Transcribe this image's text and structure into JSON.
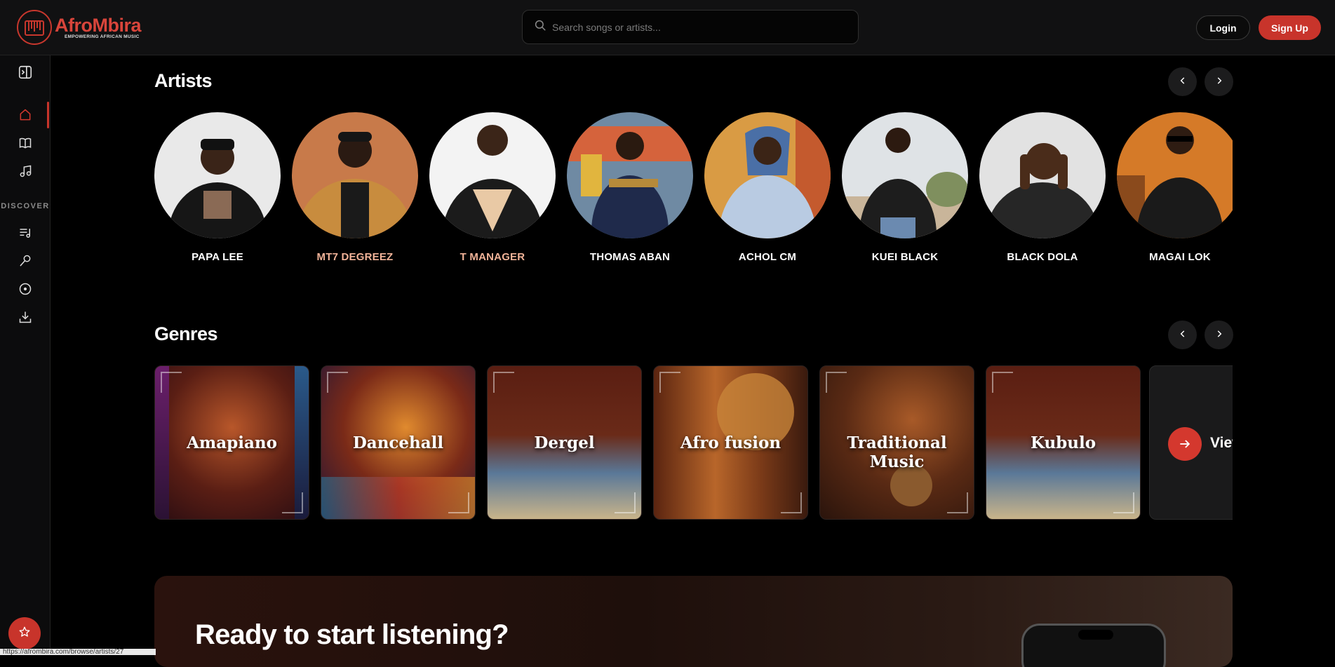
{
  "app": {
    "name": "AfroMbira",
    "tagline": "EMPOWERING AFRICAN MUSIC"
  },
  "header": {
    "search_placeholder": "Search songs or artists...",
    "login_label": "Login",
    "signup_label": "Sign Up"
  },
  "sidebar": {
    "discover_label": "DISCOVER",
    "items": [
      {
        "name": "toggle-sidebar-icon"
      },
      {
        "name": "home-icon",
        "active": true
      },
      {
        "name": "book-icon"
      },
      {
        "name": "music-note-icon"
      },
      {
        "name": "playlist-icon"
      },
      {
        "name": "microphone-icon"
      },
      {
        "name": "disc-icon"
      },
      {
        "name": "download-icon"
      }
    ]
  },
  "artists_section": {
    "title": "Artists",
    "artists": [
      {
        "name": "PAPA LEE",
        "highlight": false
      },
      {
        "name": "MT7 DEGREEZ",
        "highlight": true
      },
      {
        "name": "T MANAGER",
        "highlight": true
      },
      {
        "name": "THOMAS ABAN",
        "highlight": false
      },
      {
        "name": "ACHOL CM",
        "highlight": false
      },
      {
        "name": "KUEI BLACK",
        "highlight": false
      },
      {
        "name": "BLACK DOLA",
        "highlight": false
      },
      {
        "name": "MAGAI LOK",
        "highlight": false
      }
    ]
  },
  "genres_section": {
    "title": "Genres",
    "genres": [
      {
        "label": "Amapiano"
      },
      {
        "label": "Dancehall"
      },
      {
        "label": "Dergel"
      },
      {
        "label": "Afro fusion"
      },
      {
        "label": "Traditional Music"
      },
      {
        "label": "Kubulo"
      }
    ],
    "view_all_label": "View"
  },
  "cta": {
    "title": "Ready to start listening?"
  },
  "status_bar": {
    "url": "https://afrombira.com/browse/artists/27"
  },
  "colors": {
    "accent": "#c8342b",
    "highlight_text": "#f1b398",
    "background": "#000000"
  }
}
